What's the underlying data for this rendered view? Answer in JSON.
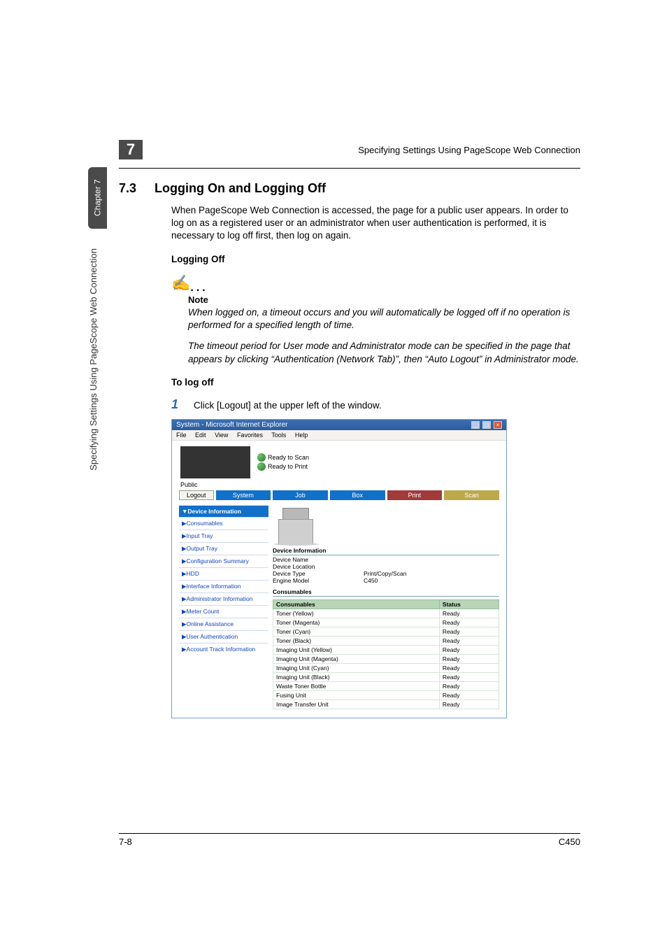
{
  "page": {
    "chapter_badge": "7",
    "running_head": "Specifying Settings Using PageScope Web Connection",
    "vertical_tab": "Chapter 7",
    "vertical_label": "Specifying Settings Using PageScope Web Connection",
    "footer_left": "7-8",
    "footer_right": "C450"
  },
  "section": {
    "number": "7.3",
    "title": "Logging On and Logging Off",
    "intro": "When PageScope Web Connection is accessed, the page for a public user appears. In order to log on as a registered user or an administrator when user authentication is performed, it is necessary to log off first, then log on again.",
    "sub1": "Logging Off",
    "note_label": "Note",
    "note_p1": "When logged on, a timeout occurs and you will automatically be logged off if no operation is performed for a specified length of time.",
    "note_p2": "The timeout period for User mode and Administrator mode can be specified in the page that appears by clicking “Authentication (Network Tab)”, then “Auto Logout” in Administrator mode.",
    "sub2": "To log off",
    "step1_num": "1",
    "step1_text": "Click [Logout] at the upper left of the window."
  },
  "screenshot": {
    "window_title": "System - Microsoft Internet Explorer",
    "menubar": [
      "File",
      "Edit",
      "View",
      "Favorites",
      "Tools",
      "Help"
    ],
    "ready1": "Ready to Scan",
    "ready2": "Ready to Print",
    "public_label": "Public",
    "logout_btn": "Logout",
    "tabs": [
      "System",
      "Job",
      "Box",
      "Print",
      "Scan"
    ],
    "sidebar": [
      "▼Device Information",
      "▶Consumables",
      "▶Input Tray",
      "▶Output Tray",
      "▶Configuration Summary",
      "▶HDD",
      "▶Interface Information",
      "▶Administrator Information",
      "▶Meter Count",
      "▶Online Assistance",
      "▶User Authentication",
      "▶Account Track Information"
    ],
    "devinfo_head": "Device Information",
    "devinfo_rows": [
      {
        "k": "Device Name",
        "v": ""
      },
      {
        "k": "Device Location",
        "v": ""
      },
      {
        "k": "Device Type",
        "v": "Print/Copy/Scan"
      },
      {
        "k": "Engine Model",
        "v": "C450"
      }
    ],
    "cons_head": "Consumables",
    "cons_col1": "Consumables",
    "cons_col2": "Status",
    "cons_rows": [
      {
        "k": "Toner (Yellow)",
        "v": "Ready"
      },
      {
        "k": "Toner (Magenta)",
        "v": "Ready"
      },
      {
        "k": "Toner (Cyan)",
        "v": "Ready"
      },
      {
        "k": "Toner (Black)",
        "v": "Ready"
      },
      {
        "k": "Imaging Unit (Yellow)",
        "v": "Ready"
      },
      {
        "k": "Imaging Unit (Magenta)",
        "v": "Ready"
      },
      {
        "k": "Imaging Unit (Cyan)",
        "v": "Ready"
      },
      {
        "k": "Imaging Unit (Black)",
        "v": "Ready"
      },
      {
        "k": "Waste Toner Bottle",
        "v": "Ready"
      },
      {
        "k": "Fusing Unit",
        "v": "Ready"
      },
      {
        "k": "Image Transfer Unit",
        "v": "Ready"
      }
    ]
  }
}
